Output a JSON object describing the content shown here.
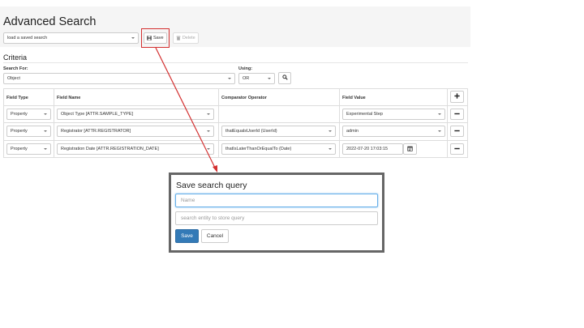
{
  "page": {
    "title": "Advanced Search",
    "saved_search_select": "load a saved search",
    "save_label": "Save",
    "delete_label": "Delete",
    "criteria_heading": "Criteria",
    "search_for_label": "Search For:",
    "search_for_value": "Object",
    "using_label": "Using:",
    "using_value": "OR"
  },
  "table": {
    "headers": {
      "field_type": "Field Type",
      "field_name": "Field Name",
      "comparator": "Comparator Operator",
      "field_value": "Field Value"
    },
    "rows": [
      {
        "field_type": "Property",
        "field_name": "Object Type [ATTR.SAMPLE_TYPE]",
        "comparator": "",
        "field_value": "Experimental Step"
      },
      {
        "field_type": "Property",
        "field_name": "Registrator [ATTR.REGISTRATOR]",
        "comparator": "thatEqualsUserId (UserId)",
        "field_value": "admin"
      },
      {
        "field_type": "Property",
        "field_name": "Registration Date [ATTR.REGISTRATION_DATE]",
        "comparator": "thatIsLaterThanOrEqualTo (Date)",
        "field_value": "2022-07-20 17:03:15"
      }
    ]
  },
  "modal": {
    "title": "Save search query",
    "name_placeholder": "Name",
    "entity_placeholder": "search entity to store query",
    "save_label": "Save",
    "cancel_label": "Cancel"
  },
  "colors": {
    "annotation": "#d32f2f",
    "primary": "#337ab7"
  },
  "icons": [
    "floppy-disk-icon",
    "trash-icon",
    "search-icon",
    "plus-icon",
    "minus-icon",
    "calendar-icon",
    "chevron-down-icon"
  ]
}
